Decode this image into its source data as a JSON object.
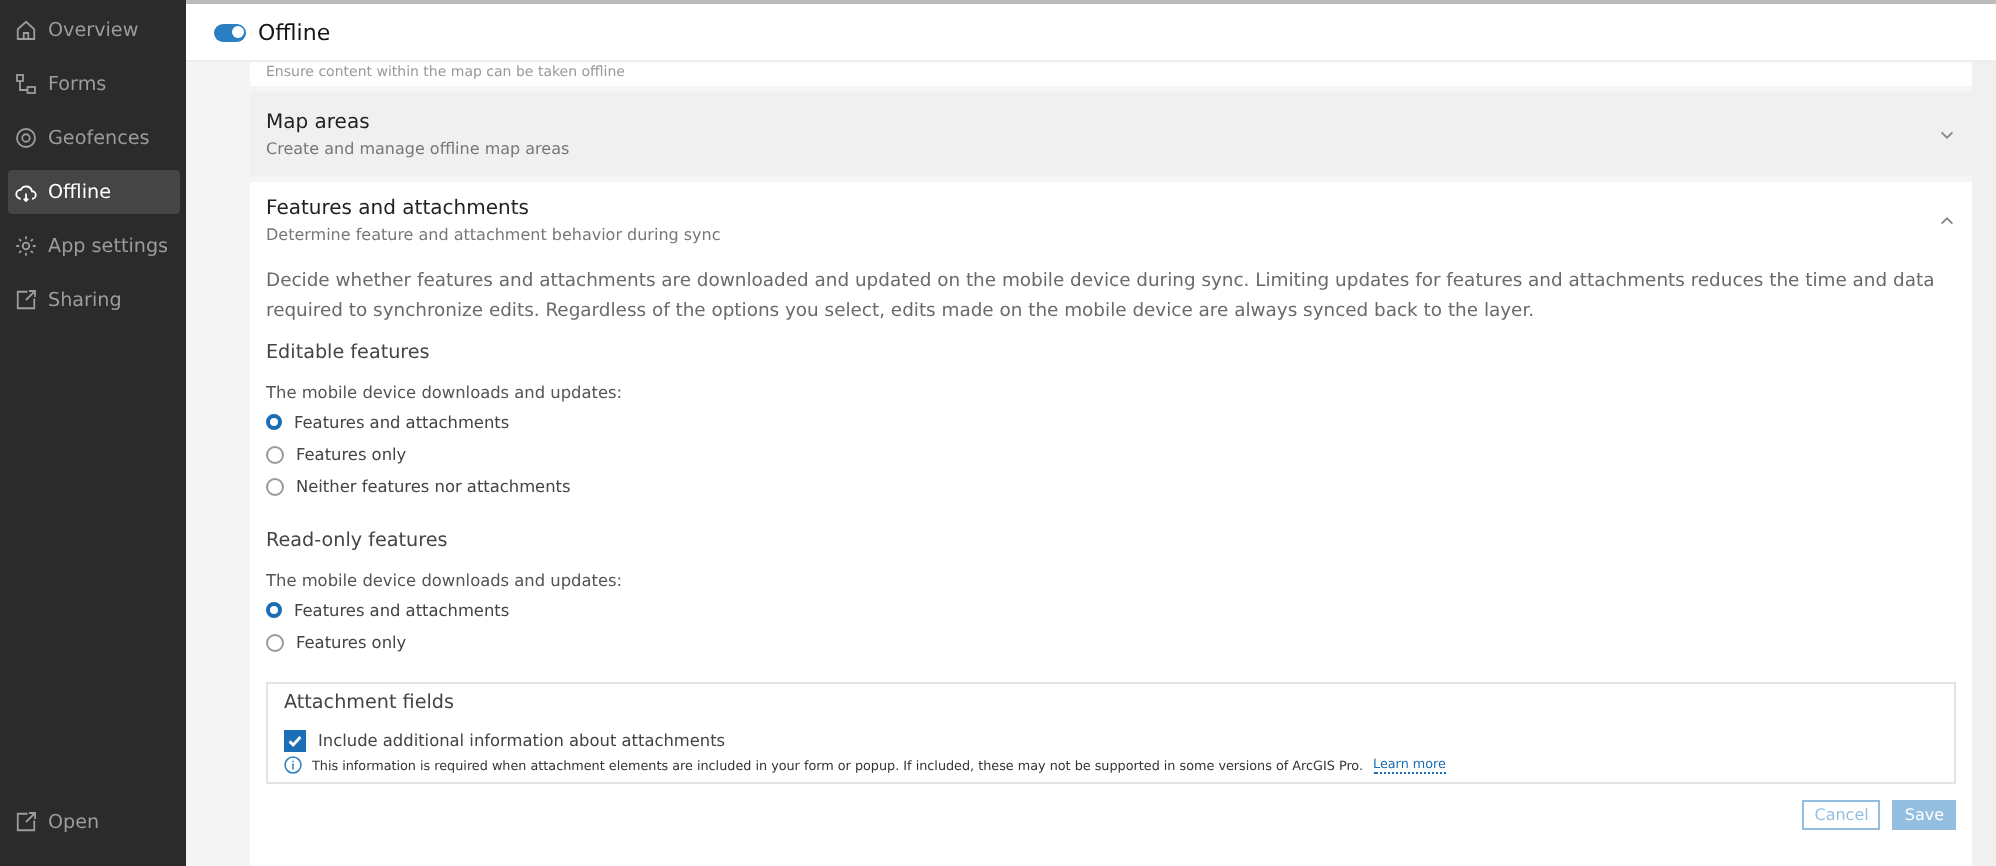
{
  "sidebar": {
    "items": [
      {
        "label": "Overview",
        "selected": false
      },
      {
        "label": "Forms",
        "selected": false
      },
      {
        "label": "Geofences",
        "selected": false
      },
      {
        "label": "Offline",
        "selected": true
      },
      {
        "label": "App settings",
        "selected": false
      },
      {
        "label": "Sharing",
        "selected": false
      }
    ],
    "footer": {
      "label": "Open"
    }
  },
  "header": {
    "toggle": {
      "label": "Offline",
      "on": true
    }
  },
  "sections": [
    {
      "subtitle": "Ensure content within the map can be taken offline"
    },
    {
      "title": "Map areas",
      "subtitle": "Create and manage offline map areas",
      "expanded": false
    },
    {
      "title": "Features and attachments",
      "subtitle": "Determine feature and attachment behavior during sync",
      "expanded": true,
      "description": "Decide whether features and attachments are downloaded and updated on the mobile device during sync. Limiting updates for features and attachments reduces the time and data required to synchronize edits. Regardless of the options you select, edits made on the mobile device are always synced back to the layer.",
      "groups": [
        {
          "heading": "Editable features",
          "prompt": "The mobile device downloads and updates:",
          "options": [
            {
              "label": "Features and attachments",
              "selected": true
            },
            {
              "label": "Features only",
              "selected": false
            },
            {
              "label": "Neither features nor attachments",
              "selected": false
            }
          ]
        },
        {
          "heading": "Read-only features",
          "prompt": "The mobile device downloads and updates:",
          "options": [
            {
              "label": "Features and attachments",
              "selected": true
            },
            {
              "label": "Features only",
              "selected": false
            }
          ]
        }
      ],
      "attachment_fields": {
        "heading": "Attachment fields",
        "checkbox": {
          "label": "Include additional information about attachments",
          "checked": true
        },
        "notice": "This information is required when attachment elements are included in your form or popup. If included, these may not be supported in some versions of ArcGIS Pro.",
        "link": "Learn more"
      }
    }
  ],
  "buttons": [
    {
      "label": "Cancel",
      "kind": "secondary",
      "disabled": true
    },
    {
      "label": "Save",
      "kind": "primary",
      "disabled": true
    }
  ]
}
